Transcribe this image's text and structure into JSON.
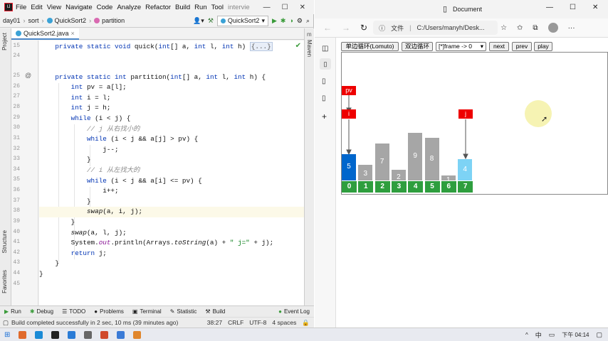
{
  "ide": {
    "menu": [
      "File",
      "Edit",
      "View",
      "Navigate",
      "Code",
      "Analyze",
      "Refactor",
      "Build",
      "Run",
      "Tool"
    ],
    "title_suffix": "intervie",
    "breadcrumb": [
      "day01",
      "sort",
      "QuickSort2",
      "partition"
    ],
    "run_config": "QuickSort2",
    "tab": "QuickSort2.java",
    "left_panels": [
      "Project",
      "Structure",
      "Favorites"
    ],
    "right_panels": [
      "m",
      "Maven"
    ],
    "line_numbers": [
      "15",
      "24",
      "25",
      "26",
      "27",
      "28",
      "29",
      "30",
      "31",
      "32",
      "33",
      "34",
      "35",
      "36",
      "37",
      "38",
      "39",
      "40",
      "41",
      "42",
      "43",
      "44",
      "45"
    ],
    "bottom_tools": [
      "Run",
      "Debug",
      "TODO",
      "Problems",
      "Terminal",
      "Statistic",
      "Build",
      "Event Log"
    ],
    "status": {
      "message": "Build completed successfully in 2 sec, 10 ms (39 minutes ago)",
      "position": "38:27",
      "line_sep": "CRLF",
      "encoding": "UTF-8",
      "indent": "4 spaces"
    },
    "colors": {
      "keyword": "#0033b3",
      "comment": "#8c8c8c",
      "field": "#871094"
    }
  },
  "browser": {
    "title": "Document",
    "address_label": "文件",
    "address": "C:/Users/manyh/Desk...",
    "controls": {
      "lomuto": "单边循环(Lomuto)",
      "double": "双边循环",
      "frame_select": "[*]frame -> 0",
      "next": "next",
      "prev": "prev",
      "play": "play"
    },
    "viz": {
      "values": [
        5,
        3,
        7,
        2,
        9,
        8,
        1,
        4
      ],
      "indices": [
        "0",
        "1",
        "2",
        "3",
        "4",
        "5",
        "6",
        "7"
      ],
      "highlight": {
        "0": "#0066cc",
        "7": "#7dd3f5"
      },
      "bar_color": "#a6a6a6",
      "pointers": {
        "pv": "pv",
        "i": "i",
        "j": "j"
      },
      "pointer_positions": {
        "pv": 0,
        "i": 0,
        "j": 7
      }
    }
  },
  "taskbar": {
    "ime": "中",
    "time": "下午 04:14"
  }
}
